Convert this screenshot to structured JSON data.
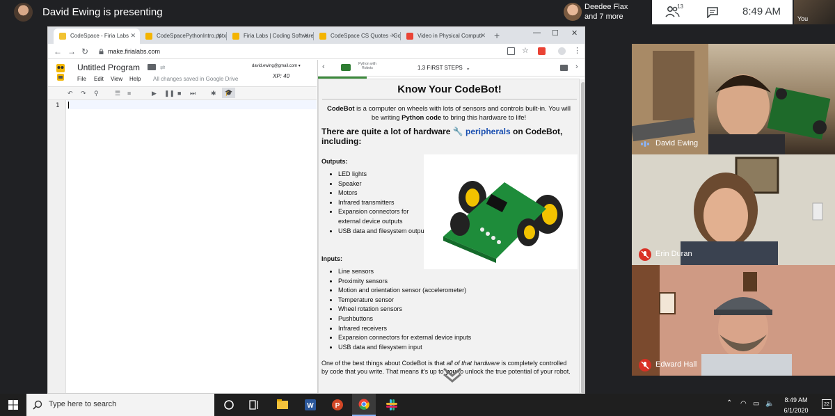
{
  "meet": {
    "presenting": "David Ewing is presenting",
    "others_name": "Deedee Flax",
    "others_more": "and 7 more",
    "people_count": "13",
    "time": "8:49 AM",
    "self_label": "You"
  },
  "browser": {
    "tabs": [
      {
        "label": "CodeSpace - Firia Labs",
        "color": "#f1c232"
      },
      {
        "label": "CodeSpacePythonIntro.pptx",
        "color": "#f4b400"
      },
      {
        "label": "Firia Labs | Coding Software",
        "color": "#f4b400"
      },
      {
        "label": "CodeSpace CS Quotes - Go",
        "color": "#f4b400"
      },
      {
        "label": "Video in Physical Computi",
        "color": "#ea4335"
      }
    ],
    "url": "make.firialabs.com",
    "controls": {
      "minimize": "—",
      "maximize": "☐",
      "close": "✕"
    }
  },
  "editor": {
    "title": "Untitled Program",
    "menus": [
      "File",
      "Edit",
      "View",
      "Help"
    ],
    "save_status": "All changes saved in Google Drive",
    "email": "david.ewing@gmail.com",
    "xp": "XP: 40",
    "line_number": "1"
  },
  "lesson": {
    "course": "Python with Robots",
    "step": "1.3 FIRST STEPS",
    "title": "Know Your CodeBot!",
    "intro_bold1": "CodeBot",
    "intro_t1": " is a computer on wheels with lots of sensors and controls built-in. You will be writing ",
    "intro_bold2": "Python code",
    "intro_t2": " to bring this hardware to life!",
    "h2_pre": "There are quite a lot of hardware ",
    "h2_link": "peripherals",
    "h2_post": " on CodeBot, including:",
    "outputs_label": "Outputs:",
    "outputs": [
      "LED lights",
      "Speaker",
      "Motors",
      "Infrared transmitters",
      "Expansion connectors for external device outputs",
      "USB data and filesystem output"
    ],
    "inputs_label": "Inputs:",
    "inputs": [
      "Line sensors",
      "Proximity sensors",
      "Motion and orientation sensor (accelerometer)",
      "Temperature sensor",
      "Wheel rotation sensors",
      "Pushbuttons",
      "Infrared receivers",
      "Expansion connectors for external device inputs",
      "USB data and filesystem input"
    ],
    "closing_t1": "One of the best things about CodeBot is that ",
    "closing_i": "all of that hardware",
    "closing_t2": " is completely controlled by code that you write. That means it's up to ",
    "closing_b": "you",
    "closing_t3": " to unlock the true potential of your robot."
  },
  "participants": [
    {
      "name": "David Ewing",
      "muted": false
    },
    {
      "name": "Erin Duran",
      "muted": true
    },
    {
      "name": "Edward Hall",
      "muted": true
    }
  ],
  "taskbar": {
    "search_placeholder": "Type here to search",
    "time": "8:49 AM",
    "date": "6/1/2020",
    "notifications": "22"
  }
}
